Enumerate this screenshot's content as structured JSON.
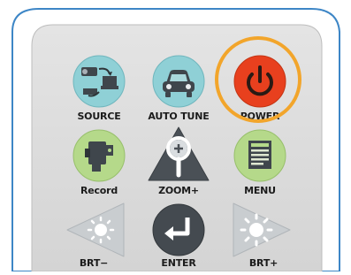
{
  "buttons": {
    "source": {
      "label": "SOURCE",
      "icon": "source-devices-icon"
    },
    "auto_tune": {
      "label": "AUTO TUNE",
      "icon": "car-icon"
    },
    "power": {
      "label": "POWER",
      "icon": "power-icon",
      "highlighted": true
    },
    "record": {
      "label": "Record",
      "icon": "camcorder-icon"
    },
    "zoom_plus": {
      "label": "ZOOM+",
      "icon": "magnifier-plus-icon"
    },
    "menu": {
      "label": "MENU",
      "icon": "menu-document-icon"
    },
    "brt_minus": {
      "label": "BRT−",
      "icon": "brightness-down-icon"
    },
    "enter": {
      "label": "ENTER",
      "icon": "enter-return-icon"
    },
    "brt_plus": {
      "label": "BRT+",
      "icon": "brightness-up-icon"
    }
  },
  "colors": {
    "panel": "#dcdcdc",
    "outline": "#3d86c6",
    "button_dark": "#444a50",
    "button_green": "#b5d98a",
    "button_teal": "#8fd0d6",
    "power_red": "#e8401e",
    "highlight_ring": "#f2a52b"
  }
}
